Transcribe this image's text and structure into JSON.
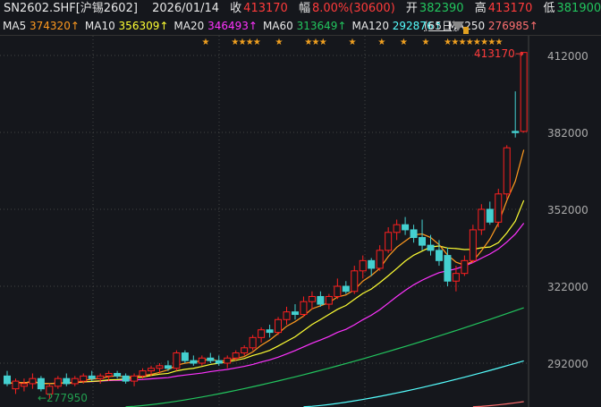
{
  "header": {
    "symbol": "SN2602.SHF[沪锡2602]",
    "date": "2026/01/14",
    "close_label": "收",
    "close": "413170",
    "change_label": "幅",
    "change": "8.00%(30600)",
    "open_label": "开",
    "open": "382390",
    "high_label": "高",
    "high": "413170",
    "low_label": "低",
    "low": "381900"
  },
  "ma_legend": [
    {
      "name": "MA5",
      "value": "374320↑",
      "color": "#ff9a1f"
    },
    {
      "name": "MA10",
      "value": "356309↑",
      "color": "#ffff33"
    },
    {
      "name": "MA20",
      "value": "346493↑",
      "color": "#ff33ff"
    },
    {
      "name": "MA60",
      "value": "313649↑",
      "color": "#22c55e"
    },
    {
      "name": "MA120",
      "value": "292876↑",
      "color": "#55ffff"
    },
    {
      "name": "MA250",
      "value": "276985↑",
      "color": "#ff7070"
    }
  ],
  "period": "(65日)",
  "chart_data": {
    "type": "candlestick",
    "unit": "thousand",
    "y_ticks": [
      412000,
      382000,
      352000,
      322000,
      292000
    ],
    "ylim": [
      274900,
      418000
    ],
    "max_label": "413170",
    "min_label": "277950",
    "up_color": "#ff2020",
    "down_color": "#44d0d0",
    "ohlc_k": [
      [
        287,
        289,
        283,
        284
      ],
      [
        282,
        286,
        280,
        285
      ],
      [
        283,
        286,
        281,
        284
      ],
      [
        284,
        288,
        282,
        286
      ],
      [
        286,
        287,
        281,
        282
      ],
      [
        280,
        284,
        277.95,
        283
      ],
      [
        283,
        287,
        282,
        286
      ],
      [
        286,
        288,
        283,
        284
      ],
      [
        284,
        287,
        283,
        286
      ],
      [
        285,
        288,
        284,
        287
      ],
      [
        287,
        289,
        285,
        286
      ],
      [
        286,
        288,
        284,
        287
      ],
      [
        287,
        289,
        285,
        288
      ],
      [
        288,
        289,
        286,
        287
      ],
      [
        287,
        288,
        284,
        285
      ],
      [
        285,
        288,
        283,
        287
      ],
      [
        287,
        290,
        286,
        289
      ],
      [
        289,
        291,
        287,
        290
      ],
      [
        290,
        292,
        288,
        291
      ],
      [
        291,
        293,
        289,
        290
      ],
      [
        290,
        297,
        289,
        296
      ],
      [
        296,
        297,
        292,
        293
      ],
      [
        293,
        295,
        291,
        292
      ],
      [
        292,
        295,
        291,
        294
      ],
      [
        294,
        296,
        292,
        293
      ],
      [
        293,
        295,
        291,
        292
      ],
      [
        292,
        295,
        290,
        294
      ],
      [
        294,
        297,
        293,
        296
      ],
      [
        296,
        299,
        295,
        298
      ],
      [
        298,
        303,
        297,
        302
      ],
      [
        302,
        306,
        300,
        305
      ],
      [
        305,
        307,
        302,
        304
      ],
      [
        304,
        310,
        303,
        309
      ],
      [
        309,
        314,
        307,
        312
      ],
      [
        312,
        315,
        309,
        311
      ],
      [
        311,
        318,
        310,
        316
      ],
      [
        316,
        320,
        313,
        318
      ],
      [
        318,
        320,
        314,
        315
      ],
      [
        315,
        319,
        313,
        318
      ],
      [
        318,
        325,
        317,
        322
      ],
      [
        322,
        324,
        319,
        320
      ],
      [
        320,
        330,
        319,
        328
      ],
      [
        328,
        334,
        325,
        332
      ],
      [
        332,
        333,
        326,
        329
      ],
      [
        329,
        338,
        328,
        336
      ],
      [
        336,
        345,
        335,
        343
      ],
      [
        343,
        348,
        340,
        346
      ],
      [
        346,
        349,
        342,
        344
      ],
      [
        344,
        346,
        339,
        341
      ],
      [
        341,
        348,
        336,
        338
      ],
      [
        338,
        342,
        334,
        336
      ],
      [
        336,
        340,
        330,
        332
      ],
      [
        334,
        337,
        322,
        324
      ],
      [
        324,
        330,
        320,
        327
      ],
      [
        327,
        334,
        326,
        332
      ],
      [
        332,
        346,
        331,
        344
      ],
      [
        344,
        354,
        342,
        352
      ],
      [
        352,
        355,
        346,
        347
      ],
      [
        347,
        360,
        345,
        358
      ],
      [
        358,
        377,
        356,
        376
      ],
      [
        382.4,
        398,
        380,
        381.9
      ],
      [
        382.39,
        413.17,
        381.9,
        413.17
      ]
    ],
    "ma60_k": [
      [
        14,
        275
      ],
      [
        61,
        313.6
      ]
    ],
    "ma120_k": [
      [
        35,
        275
      ],
      [
        61,
        292.9
      ]
    ],
    "ma250_k": [
      [
        55,
        275
      ],
      [
        61,
        277
      ]
    ],
    "star_indices": [
      23,
      27,
      28,
      29,
      30,
      33,
      37,
      38,
      39,
      43,
      47,
      50,
      53,
      56,
      57,
      58,
      59,
      60,
      61,
      62,
      63
    ]
  }
}
